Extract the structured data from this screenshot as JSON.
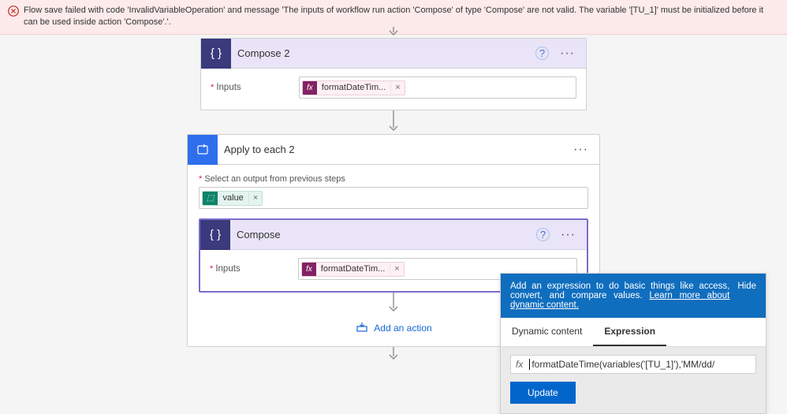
{
  "error": {
    "message": "Flow save failed with code 'InvalidVariableOperation' and message 'The inputs of workflow run action 'Compose' of type 'Compose' are not valid. The variable '[TU_1]' must be initialized before it can be used inside action 'Compose'.'."
  },
  "compose2": {
    "title": "Compose 2",
    "inputs_label": "Inputs",
    "token": "formatDateTim..."
  },
  "loop": {
    "title": "Apply to each 2",
    "select_label": "Select an output from previous steps",
    "value_token": "value",
    "compose": {
      "title": "Compose",
      "inputs_label": "Inputs",
      "token": "formatDateTim..."
    },
    "add_action": "Add an action"
  },
  "popup": {
    "tip_text": "Add an expression to do basic things like access, convert, and compare values. ",
    "tip_link": "Learn more about dynamic content.",
    "hide": "Hide",
    "tabs": {
      "dynamic": "Dynamic content",
      "expression": "Expression"
    },
    "fx": "fx",
    "expression": "formatDateTime(variables('[TU_1]'),'MM/dd/",
    "update": "Update"
  }
}
